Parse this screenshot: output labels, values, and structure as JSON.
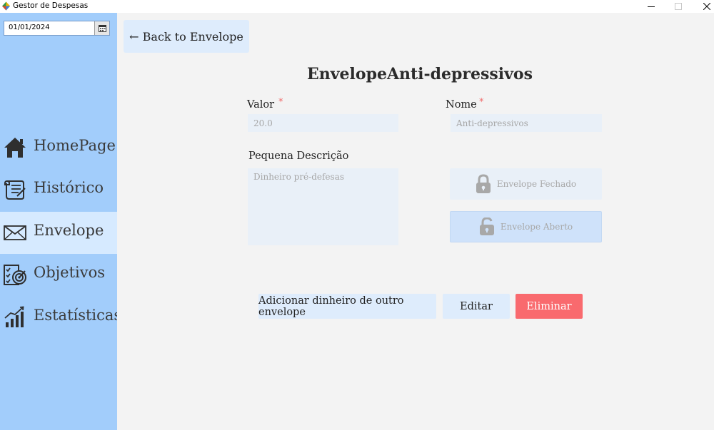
{
  "window": {
    "title": "Gestor de Despesas"
  },
  "sidebar": {
    "date_value": "01/01/2024",
    "items": [
      {
        "label": "HomePage",
        "icon": "home-icon",
        "active": false
      },
      {
        "label": "Histórico",
        "icon": "history-scroll-icon",
        "active": false
      },
      {
        "label": "Envelope",
        "icon": "envelope-icon",
        "active": true
      },
      {
        "label": "Objetivos",
        "icon": "goals-target-icon",
        "active": false
      },
      {
        "label": "Estatísticas",
        "icon": "statistics-chart-icon",
        "active": false
      }
    ]
  },
  "main": {
    "back_label": "← Back to Envelope",
    "title": "EnvelopeAnti-depressivos",
    "valor_label": "Valor",
    "valor_value": "20.0",
    "nome_label": "Nome",
    "nome_value": "Anti-depressivos",
    "required_mark": "*",
    "descricao_label": "Pequena Descrição",
    "descricao_value": "Dinheiro pré-defesas",
    "envelope_fechado_label": "Envelope Fechado",
    "envelope_aberto_label": "Envelope Aberto",
    "add_money_label": "Adicionar dinheiro de outro envelope",
    "edit_label": "Editar",
    "delete_label": "Eliminar"
  },
  "colors": {
    "sidebar_bg": "#a2cdfb",
    "active_item_bg": "#d6eaff",
    "main_bg": "#f3f3f3",
    "button_bg": "#deecfc",
    "delete_bg": "#f96a6e",
    "required": "#f06a6a"
  }
}
